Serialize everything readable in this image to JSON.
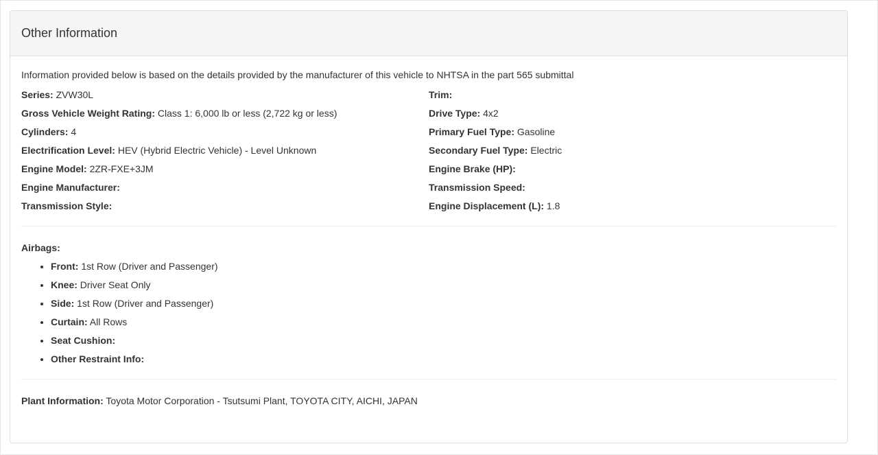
{
  "panel": {
    "title": "Other Information"
  },
  "intro": "Information provided below is based on the details provided by the manufacturer of this vehicle to NHTSA in the part 565 submittal",
  "specs_left": [
    {
      "label": "Series:",
      "value": "ZVW30L"
    },
    {
      "label": "Gross Vehicle Weight Rating:",
      "value": "Class 1: 6,000 lb or less (2,722 kg or less)"
    },
    {
      "label": "Cylinders:",
      "value": "4"
    },
    {
      "label": "Electrification Level:",
      "value": "HEV (Hybrid Electric Vehicle) - Level Unknown"
    },
    {
      "label": "Engine Model:",
      "value": "2ZR-FXE+3JM"
    },
    {
      "label": "Engine Manufacturer:",
      "value": ""
    },
    {
      "label": "Transmission Style:",
      "value": ""
    }
  ],
  "specs_right": [
    {
      "label": "Trim:",
      "value": ""
    },
    {
      "label": "Drive Type:",
      "value": "4x2"
    },
    {
      "label": "Primary Fuel Type:",
      "value": "Gasoline"
    },
    {
      "label": "Secondary Fuel Type:",
      "value": "Electric"
    },
    {
      "label": "Engine Brake (HP):",
      "value": ""
    },
    {
      "label": "Transmission Speed:",
      "value": ""
    },
    {
      "label": "Engine Displacement (L):",
      "value": "1.8"
    }
  ],
  "airbags": {
    "heading": "Airbags:",
    "items": [
      {
        "label": "Front:",
        "value": "1st Row (Driver and Passenger)"
      },
      {
        "label": "Knee:",
        "value": "Driver Seat Only"
      },
      {
        "label": "Side:",
        "value": "1st Row (Driver and Passenger)"
      },
      {
        "label": "Curtain:",
        "value": "All Rows"
      },
      {
        "label": "Seat Cushion:",
        "value": ""
      },
      {
        "label": "Other Restraint Info:",
        "value": ""
      }
    ]
  },
  "plant": {
    "label": "Plant Information:",
    "value": "Toyota Motor Corporation - Tsutsumi Plant, TOYOTA CITY, AICHI, JAPAN"
  }
}
